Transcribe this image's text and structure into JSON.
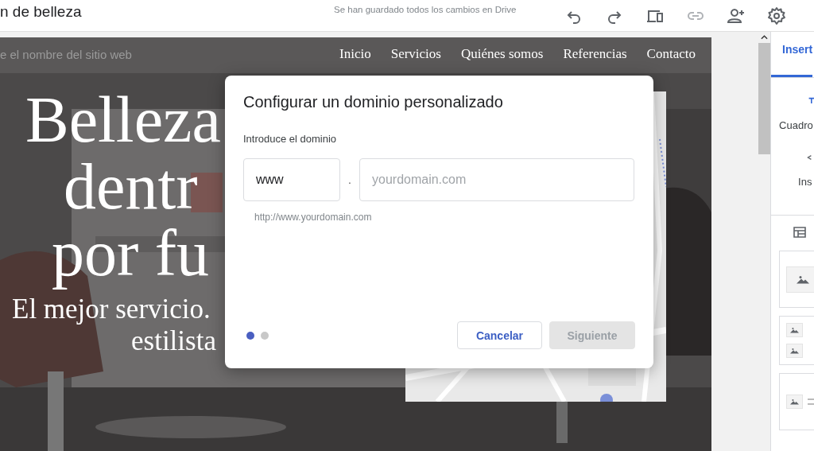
{
  "header": {
    "title": "n de belleza",
    "save_status": "Se han guardado todos los cambios en Drive"
  },
  "site": {
    "name": "e el nombre del sitio web",
    "nav": [
      {
        "label": "Inicio"
      },
      {
        "label": "Servicios"
      },
      {
        "label": "Quiénes somos"
      },
      {
        "label": "Referencias"
      },
      {
        "label": "Contacto"
      }
    ],
    "hero_lines": [
      "Belleza",
      "dentr",
      "por fu"
    ],
    "subtitle_lines": [
      "El mejor servicio.",
      "estilista"
    ]
  },
  "dialog": {
    "title": "Configurar un dominio personalizado",
    "label": "Introduce el dominio",
    "subdomain": {
      "value": "www"
    },
    "separator": ".",
    "domain": {
      "placeholder": "yourdomain.com"
    },
    "preview": "http://www.yourdomain.com",
    "steps": [
      {
        "selected": true
      },
      {
        "selected": false
      }
    ],
    "buttons": [
      {
        "label": "Cancelar",
        "kind": "secondary",
        "disabled": false
      },
      {
        "label": "Siguiente",
        "kind": "primary",
        "disabled": true
      }
    ]
  },
  "panel": {
    "tabs": [
      {
        "label": "Insert",
        "selected": true
      }
    ],
    "items": [
      {
        "label": "Cuadro",
        "kind": "text-box"
      },
      {
        "label": "Ins",
        "kind": "embed"
      }
    ]
  }
}
